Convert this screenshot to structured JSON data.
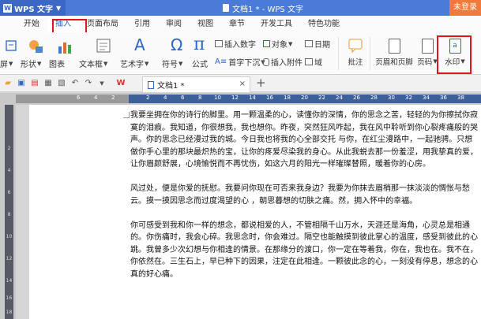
{
  "app": {
    "name": "WPS 文字",
    "window_title": "文档1 * - WPS 文字",
    "login_label": "未登录"
  },
  "menu": {
    "items": [
      "开始",
      "插入",
      "页面布局",
      "引用",
      "审阅",
      "视图",
      "章节",
      "开发工具",
      "特色功能"
    ],
    "active": "插入"
  },
  "ribbon": {
    "row1": {
      "insert_number": "插入数字",
      "object": "对象",
      "date": "日期"
    },
    "row2": {
      "first_sink": "首字下沉",
      "attachment": "插入附件",
      "field": "域"
    },
    "bottom_left": {
      "screenshot": "屏",
      "shape": "形状",
      "chart": "图表",
      "textbox": "文本框",
      "wordart": "艺术字",
      "symbol": "符号",
      "formula": "公式"
    },
    "big": {
      "comment": "批注",
      "header_footer": "页眉和页脚",
      "page_number": "页码",
      "watermark": "水印"
    }
  },
  "document_tab": {
    "name": "文档1 *"
  },
  "ruler": {
    "numbers": [
      "6",
      "4",
      "2",
      "2",
      "4",
      "6",
      "8",
      "10",
      "12",
      "14",
      "16",
      "18",
      "20",
      "22",
      "24",
      "26",
      "28",
      "30",
      "32",
      "34",
      "36",
      "38"
    ]
  },
  "vruler": {
    "numbers": [
      "2",
      "4",
      "6",
      "8",
      "10",
      "12",
      "14",
      "16",
      "18"
    ]
  },
  "document": {
    "paragraphs": [
      "我要坐拥在你的诗行的脚里。用一颗温柔的心，读懂你的深情，你的思念之苦，轻轻的为你擦拭你寂寞的泪痕。我知道，你很想我，我也想你。昨夜，突然狂风咋起，我在风中聆听到你心裂疼痛般的哭声。你的思念已经漫过我的城。今日我也将我的心全部交托 与你，在红尘漫路中，一起驰骋。只想做你手心里的那块最炽热的宝，让你的疼爱尽染我的身心。从此我蜕去那一份羞涩，用我挚真的爱，让你眉颜舒展，心境愉悦而不再忧伤，如这六月的阳光一样璀璨替照，暖着你的心房。",
      "风过处，便是你爱的抚慰。我要问你现在可否来我身边？我要为你抹去眉梢那一抹淡淡的惆怅与愁云。摸一摸因思念而过度渴望的心 ，朝思暮想的切肤之痛。然，拥入怀中的幸福。",
      "你可感受到我和你一样的想念，都说相爱的人，不管相隔千山万水，天涯还是海角，心灵总是相通的。你伤痛时，我会心碎。我思念时，你会难过。隔空也能触摸到彼此掌心的温度，感受到彼此的心跳。我曾多少次幻想与你相逢的情景。在那缘分的渡口，你一定在等着我，你在，我也在。我不在，你依然在。三生石上，早已种下的因果，注定在此相逢。一颗彼此念的心，一刻没有停息，想念的心真的好心痛。"
    ]
  }
}
